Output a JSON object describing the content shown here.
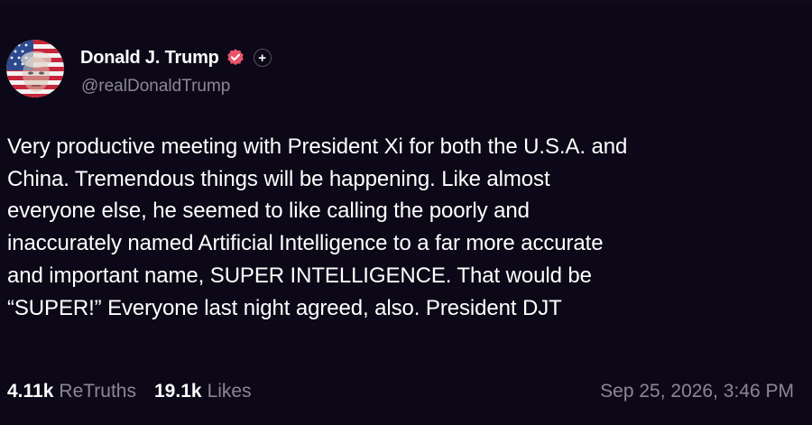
{
  "post": {
    "author": {
      "display_name": "Donald J. Trump",
      "handle": "@realDonaldTrump",
      "verified_icon": "verified-badge-icon",
      "follow_icon": "plus-icon",
      "follow_symbol": "+"
    },
    "body_lines": [
      "Very productive meeting with President Xi for both the U.S.A. and",
      "China. Tremendous things will be happening. Like almost",
      "everyone else, he seemed to like calling the poorly and",
      "inaccurately named Artificial Intelligence to a far more accurate",
      "and important name, SUPER INTELLIGENCE. That would be",
      "“SUPER!” Everyone last night agreed, also. President DJT"
    ],
    "stats": {
      "retruths_count": "4.11k",
      "retruths_label": "ReTruths",
      "likes_count": "19.1k",
      "likes_label": "Likes"
    },
    "timestamp": "Sep 25, 2026, 3:46 PM"
  },
  "colors": {
    "background": "#0c0817",
    "text_primary": "#ffffff",
    "text_secondary": "#8b8796",
    "verified_badge": "#e8536b"
  }
}
